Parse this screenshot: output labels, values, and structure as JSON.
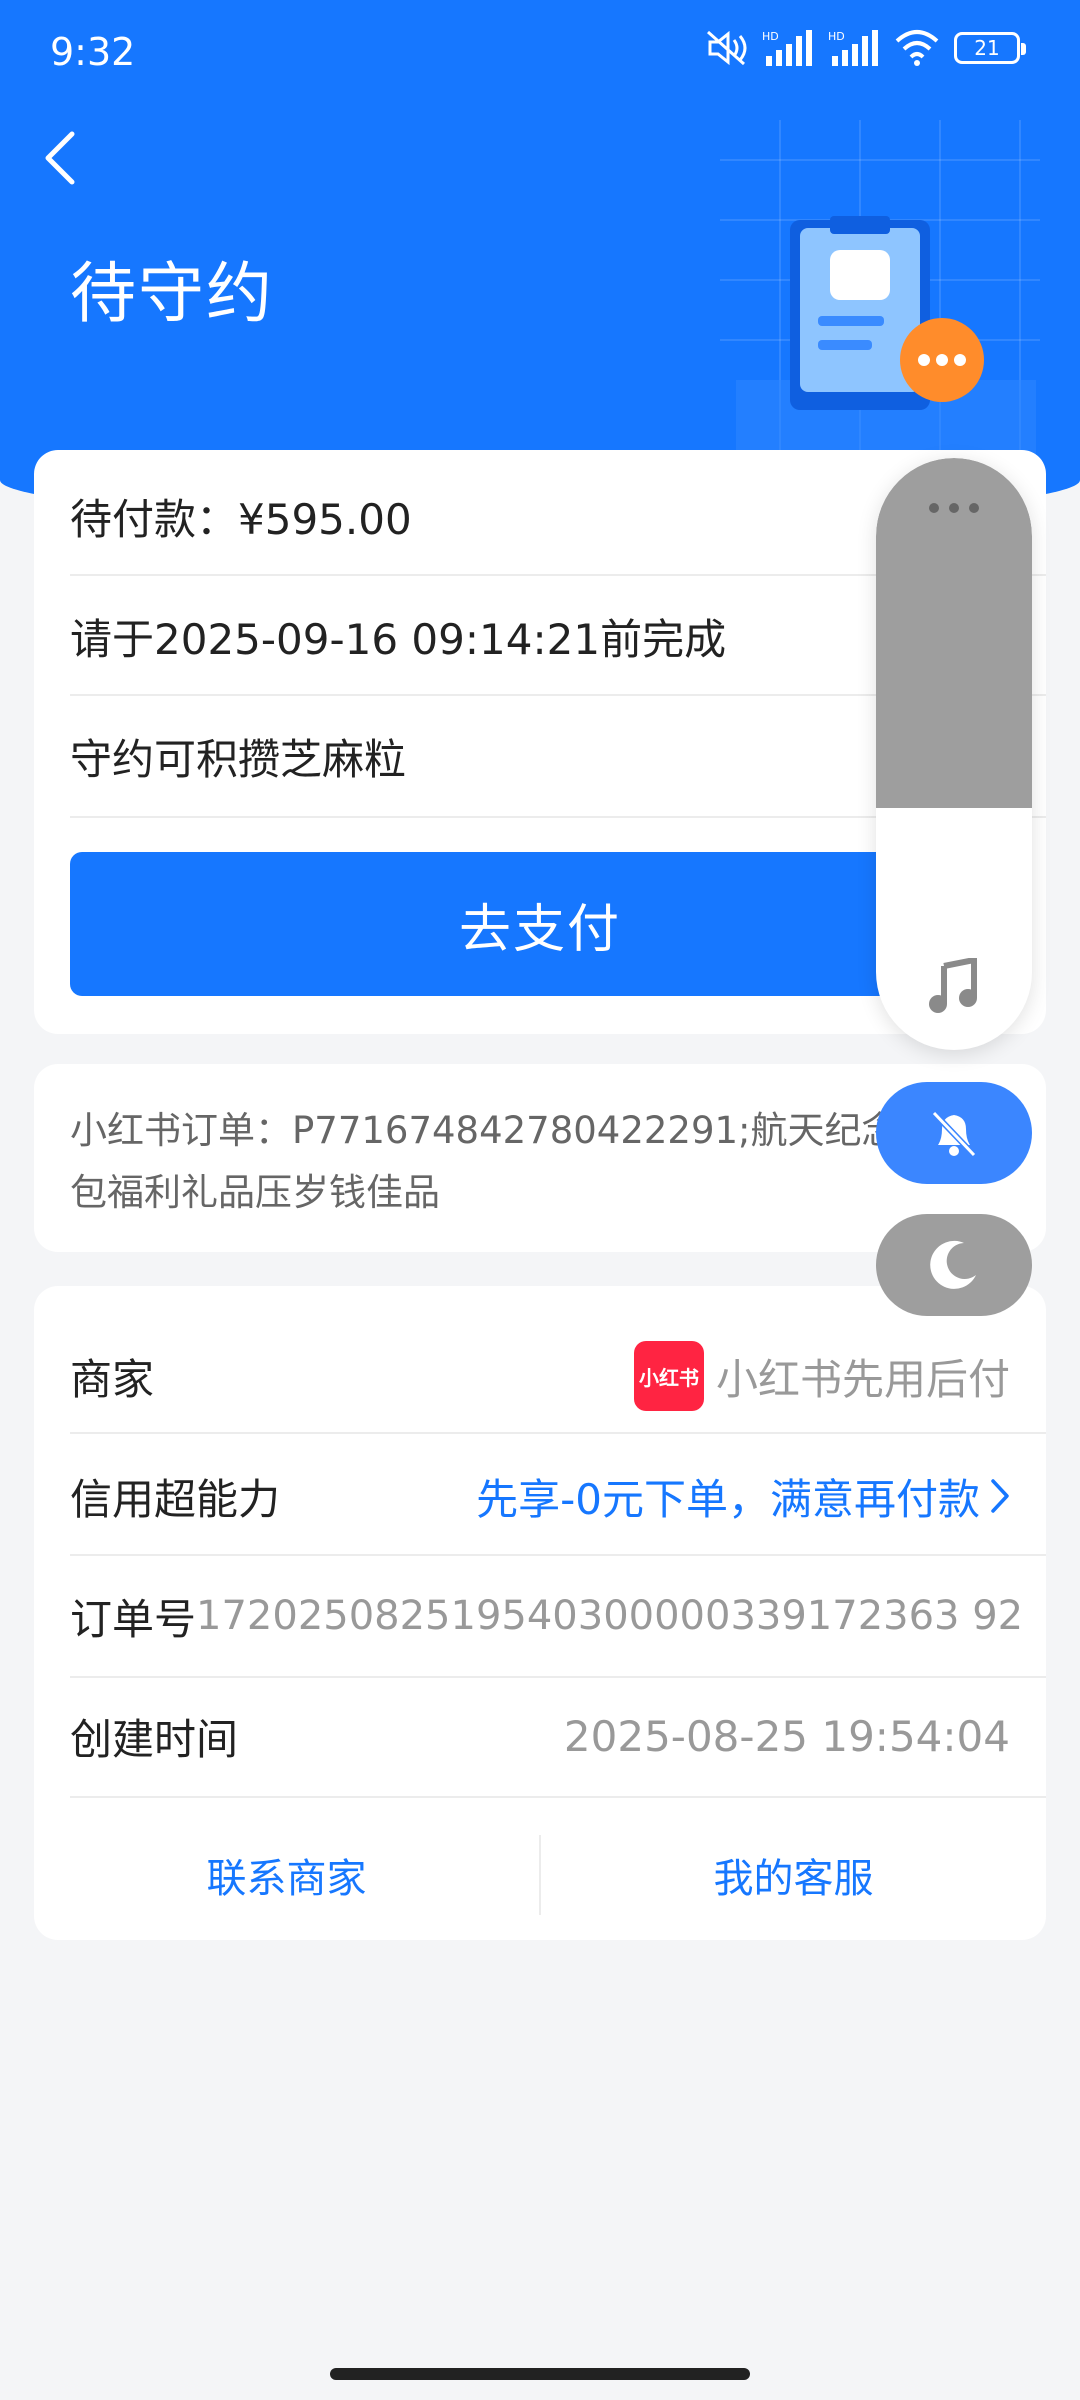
{
  "status_bar": {
    "time": "9:32",
    "battery": "21",
    "icons": [
      "mute-icon",
      "signal-hd-icon",
      "signal-hd-icon",
      "wifi-icon",
      "battery-icon"
    ]
  },
  "header": {
    "title": "待守约",
    "back_icon": "chevron-left-icon"
  },
  "payment": {
    "amount_text": "待付款：¥595.00",
    "deadline_text": "请于2025-09-16 09:14:21前完成",
    "points_text": "守约可积攒芝麻粒",
    "pay_button": "去支付"
  },
  "description": {
    "text": "小红书订单：P771674842780422291;航天纪念钞礼红包福利礼品压岁钱佳品"
  },
  "details": {
    "merchant_label": "商家",
    "merchant_logo_text": "小红书",
    "merchant_value": "小红书先用后付",
    "credit_label": "信用超能力",
    "credit_value": "先享-0元下单，满意再付款",
    "order_label": "订单号",
    "order_value": "172025082519540300000339172363 92",
    "created_label": "创建时间",
    "created_value": "2025-08-25 19:54:04",
    "contact_merchant": "联系商家",
    "my_service": "我的客服"
  },
  "colors": {
    "primary": "#1677ff",
    "background": "#f4f5f7",
    "merchant_brand": "#ff2442",
    "float_gray": "#9e9e9e"
  }
}
